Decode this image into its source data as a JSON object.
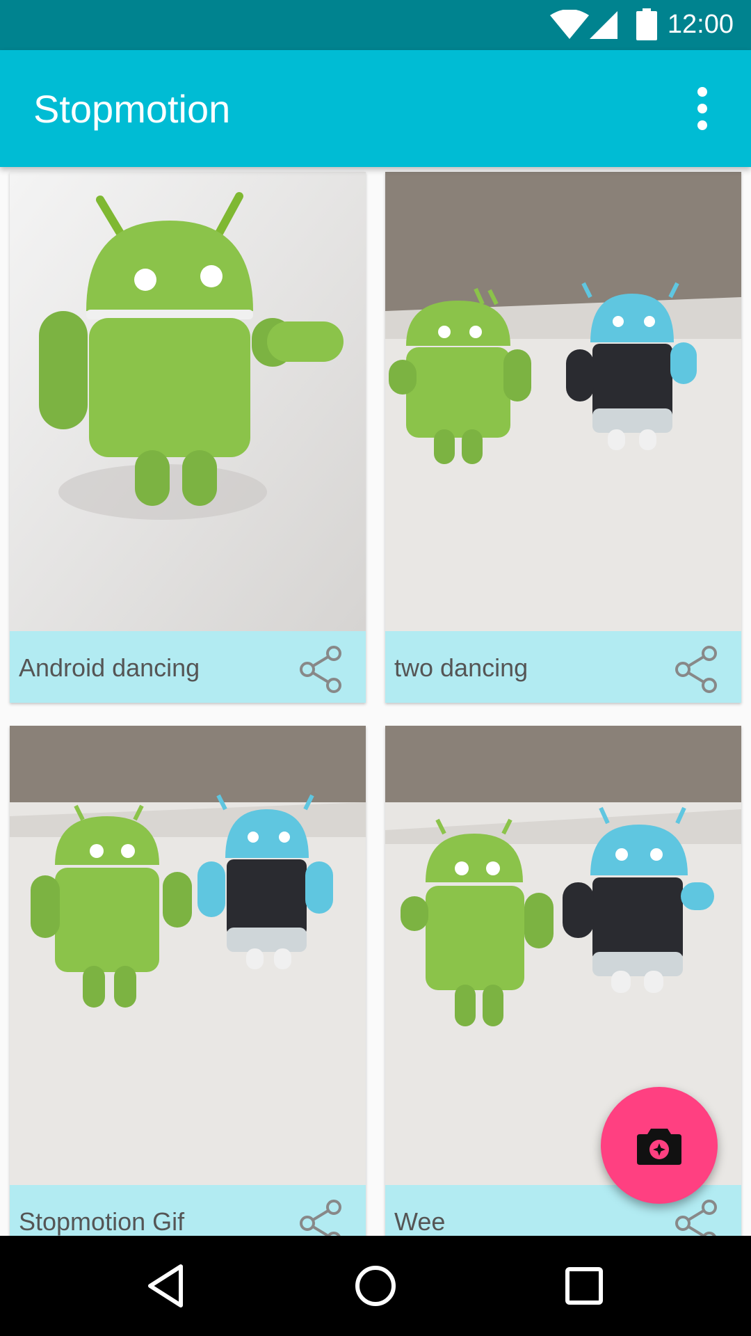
{
  "status_bar": {
    "time": "12:00",
    "icons": [
      "wifi-icon",
      "cellular-signal-icon",
      "battery-icon"
    ]
  },
  "app_bar": {
    "title": "Stopmotion",
    "menu_icon": "more-vert-icon"
  },
  "cards": [
    {
      "title": "Android dancing",
      "image": "photo of a green Android figure",
      "share_icon": "share-icon"
    },
    {
      "title": "two dancing",
      "image": "photo of a green and a blue Android figure",
      "share_icon": "share-icon"
    },
    {
      "title": "Stopmotion Gif",
      "image": "photo of a green and a blue Android figure",
      "share_icon": "share-icon"
    },
    {
      "title": "Wee",
      "image": "photo of a green and a blue Android figure",
      "share_icon": "share-icon"
    }
  ],
  "fab": {
    "icon": "camera-icon"
  },
  "nav_bar": {
    "icons": [
      "back-icon",
      "home-icon",
      "recents-icon"
    ]
  },
  "colors": {
    "status_bar": "#00838f",
    "app_bar": "#00bcd4",
    "card_caption_bg": "#b2ebf2",
    "fab": "#ff4081",
    "android_green": "#8bc34a",
    "android_blue": "#5fc6e0"
  }
}
